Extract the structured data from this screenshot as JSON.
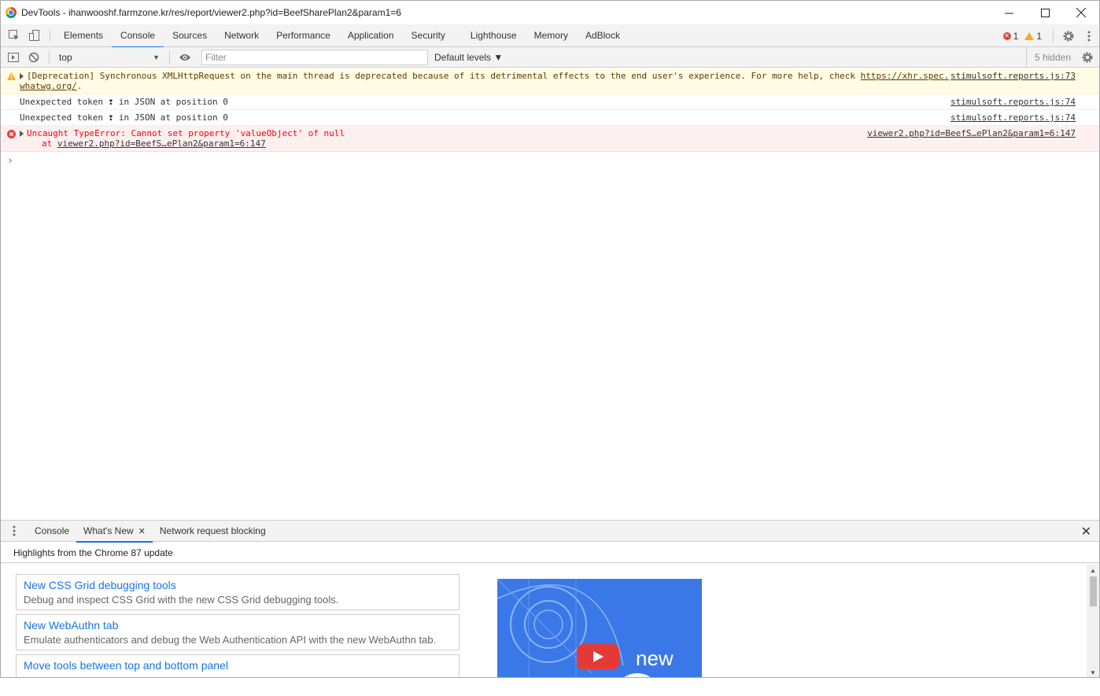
{
  "window": {
    "title": "DevTools - ihanwooshf.farmzone.kr/res/report/viewer2.php?id=BeefSharePlan2&param1=6"
  },
  "tabs": [
    "Elements",
    "Console",
    "Sources",
    "Network",
    "Performance",
    "Application",
    "Security",
    "Lighthouse",
    "Memory",
    "AdBlock"
  ],
  "status": {
    "errors": "1",
    "warnings": "1"
  },
  "toolbar": {
    "context": "top",
    "filter_placeholder": "Filter",
    "levels": "Default levels ▼",
    "hidden": "5 hidden"
  },
  "messages": {
    "warning": {
      "text": "[Deprecation] Synchronous XMLHttpRequest on the main thread is deprecated because of its detrimental effects to the end user's experience. For more help, check",
      "link1": "https://xhr.spec.",
      "link2": "whatwg.org/",
      "tail": ".",
      "source": "stimulsoft.reports.js:73"
    },
    "token1": {
      "text": "Unexpected token ❢ in JSON at position 0",
      "source": "stimulsoft.reports.js:74"
    },
    "token2": {
      "text": "Unexpected token ❢ in JSON at position 0",
      "source": "stimulsoft.reports.js:74"
    },
    "error": {
      "text": "Uncaught TypeError: Cannot set property 'valueObject' of null",
      "at": "at",
      "at_link": "viewer2.php?id=BeefS…ePlan2&param1=6:147",
      "source": "viewer2.php?id=BeefS…ePlan2&param1=6:147"
    }
  },
  "drawer": {
    "tabs": [
      "Console",
      "What's New",
      "Network request blocking"
    ],
    "highlights": "Highlights from the Chrome 87 update",
    "cards": [
      {
        "title": "New CSS Grid debugging tools",
        "desc": "Debug and inspect CSS Grid with the new CSS Grid debugging tools."
      },
      {
        "title": "New WebAuthn tab",
        "desc": "Emulate authenticators and debug the Web Authentication API with the new WebAuthn tab."
      },
      {
        "title": "Move tools between top and bottom panel",
        "desc": ""
      }
    ],
    "video_text": "new"
  },
  "colors": {
    "accent": "#1a73e8",
    "error": "#e0443e",
    "warning": "#f2ab26",
    "video_bg": "#3b78e7"
  }
}
